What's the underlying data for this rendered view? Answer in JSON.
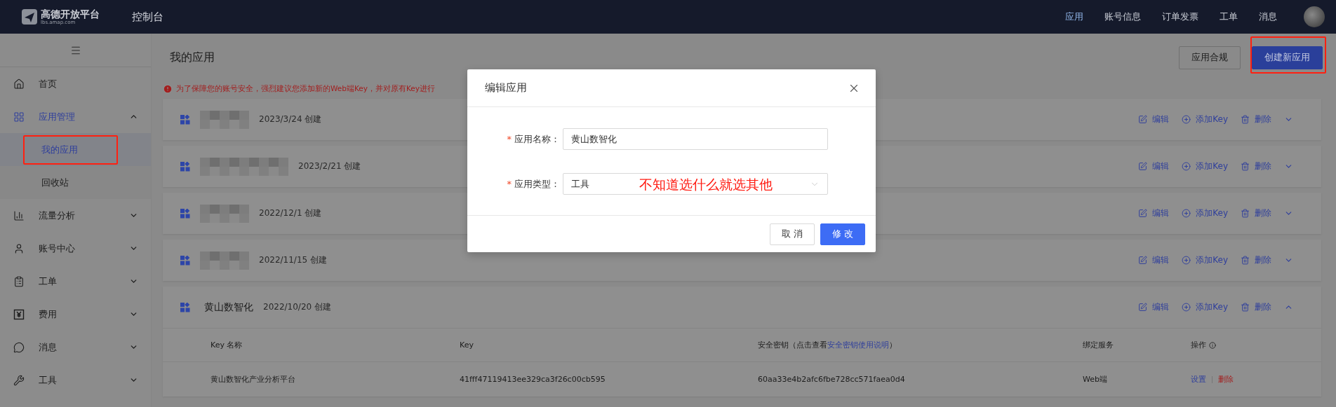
{
  "topbar": {
    "logo_text": "高德开放平台",
    "logo_subtext": "lbs.amap.com",
    "title": "控制台",
    "nav": [
      {
        "label": "应用",
        "selected": true
      },
      {
        "label": "账号信息",
        "selected": false
      },
      {
        "label": "订单发票",
        "selected": false
      },
      {
        "label": "工单",
        "selected": false
      },
      {
        "label": "消息",
        "selected": false
      }
    ]
  },
  "sidebar": {
    "items": [
      {
        "label": "首页",
        "selected": false
      },
      {
        "label": "应用管理",
        "selected": true,
        "expanded": true,
        "children": [
          {
            "label": "我的应用",
            "selected": true,
            "highlighted": true
          },
          {
            "label": "回收站",
            "selected": false,
            "highlighted": false
          }
        ]
      },
      {
        "label": "流量分析",
        "selected": false,
        "expanded": false
      },
      {
        "label": "账号中心",
        "selected": false,
        "expanded": false
      },
      {
        "label": "工单",
        "selected": false,
        "expanded": false
      },
      {
        "label": "费用",
        "selected": false,
        "expanded": false
      },
      {
        "label": "消息",
        "selected": false,
        "expanded": false
      },
      {
        "label": "工具",
        "selected": false,
        "expanded": false
      }
    ]
  },
  "page": {
    "title": "我的应用",
    "buttons": [
      {
        "label": "应用合规",
        "kind": "default",
        "highlighted": false
      },
      {
        "label": "创建新应用",
        "kind": "primary",
        "highlighted": true
      }
    ],
    "warning": "为了保障您的账号安全，强烈建议您添加新的Web端Key，并对原有Key进行"
  },
  "apps": [
    {
      "kind": "redacted",
      "date": "2023/3/24 创建",
      "expanded": false,
      "actions": [
        "编辑",
        "添加Key",
        "删除"
      ]
    },
    {
      "kind": "redacted",
      "date": "2023/2/21 创建",
      "expanded": false,
      "actions": [
        "编辑",
        "添加Key",
        "删除"
      ]
    },
    {
      "kind": "redacted",
      "date": "2022/12/1 创建",
      "expanded": false,
      "actions": [
        "编辑",
        "添加Key",
        "删除"
      ]
    },
    {
      "kind": "redacted",
      "date": "2022/11/15 创建",
      "expanded": false,
      "actions": [
        "编辑",
        "添加Key",
        "删除"
      ]
    },
    {
      "kind": "named",
      "name": "黄山数智化",
      "date": "2022/10/20 创建",
      "expanded": true,
      "actions": [
        "编辑",
        "添加Key",
        "删除"
      ],
      "table": {
        "columns": [
          {
            "label": "Key 名称"
          },
          {
            "label": "Key"
          },
          {
            "label": "安全密钥（点击查看",
            "link": "安全密钥使用说明",
            "suffix": "）"
          },
          {
            "label": "绑定服务"
          },
          {
            "label": "操作",
            "info": true
          }
        ],
        "rows": [
          {
            "key_name": "黄山数智化产业分析平台",
            "key": "41fff47119413ee329ca3f26c00cb595",
            "secret": "60aa33e4b2afc6fbe728cc571faea0d4",
            "service": "Web端",
            "actions": [
              {
                "label": "设置",
                "kind": "link"
              },
              {
                "label": "删除",
                "kind": "danger"
              }
            ]
          }
        ]
      }
    }
  ],
  "dialog": {
    "title": "编辑应用",
    "fields": [
      {
        "label": "应用名称：",
        "required_mark": "*",
        "kind": "input",
        "value": "黄山数智化"
      },
      {
        "label": "应用类型：",
        "required_mark": "*",
        "kind": "select",
        "value": "工具",
        "annotation": "不知道选什么就选其他"
      }
    ],
    "buttons": [
      {
        "label": "取 消",
        "kind": "default"
      },
      {
        "label": "修 改",
        "kind": "primary"
      }
    ]
  }
}
